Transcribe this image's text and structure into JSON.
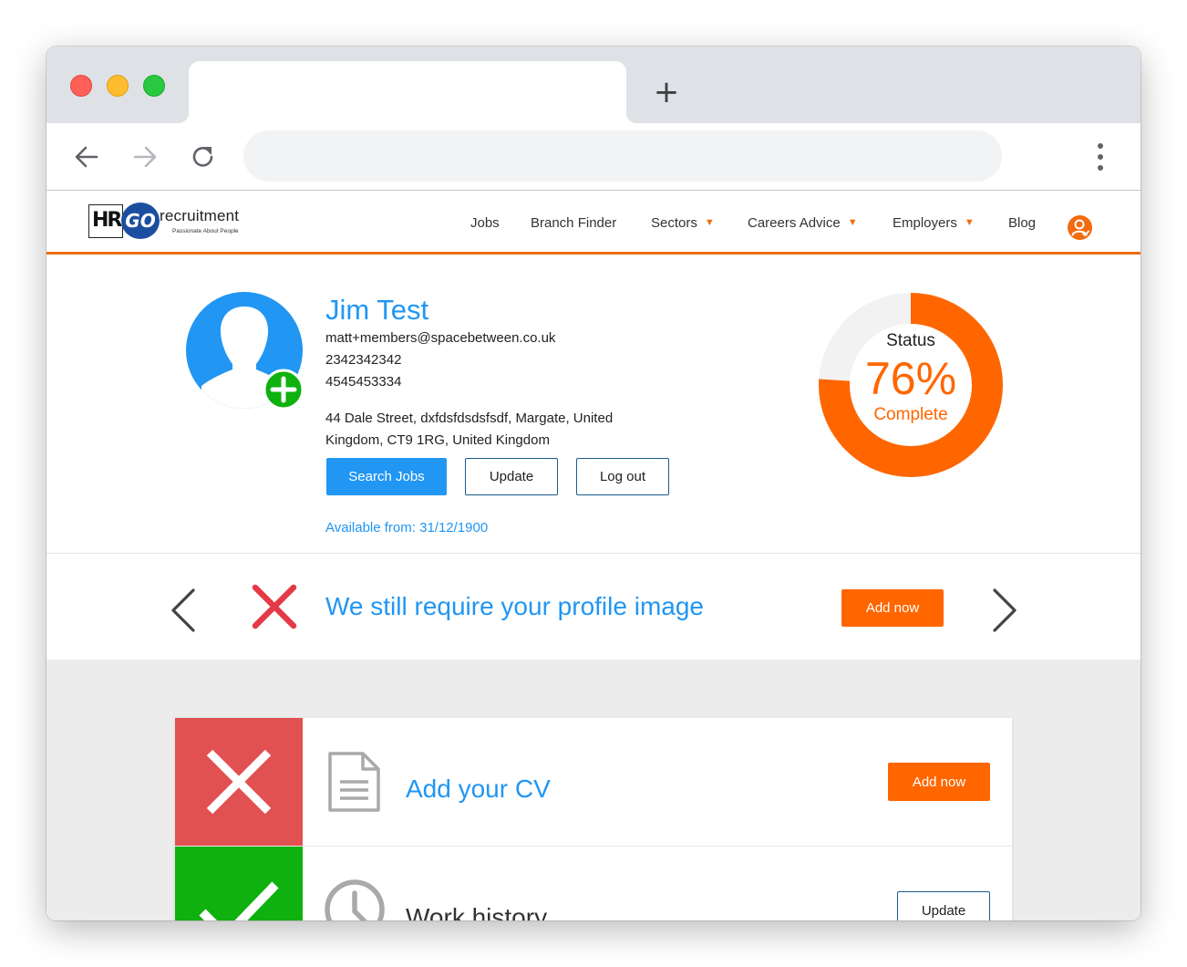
{
  "browser": {
    "new_tab_glyph": "+"
  },
  "site": {
    "logo": {
      "hr": "HR",
      "go": "GO",
      "word": "recruitment",
      "tagline": "Passionate About People"
    },
    "nav": {
      "jobs": "Jobs",
      "branch_finder": "Branch Finder",
      "sectors": "Sectors",
      "careers_advice": "Careers Advice",
      "employers": "Employers",
      "blog": "Blog",
      "caret": "▼"
    },
    "colors": {
      "brand_orange": "#f26b0f",
      "action_orange": "#ff6600",
      "accent_blue": "#2196f3",
      "error_red": "#e53946",
      "success_green": "#0eb10e"
    }
  },
  "profile": {
    "name": "Jim Test",
    "email": "matt+members@spacebetween.co.uk",
    "phone1": "2342342342",
    "phone2": "4545453334",
    "address_line1": "44 Dale Street, dxfdsfdsdsfsdf, Margate, United",
    "address_line2": "Kingdom, CT9 1RG, United Kingdom",
    "buttons": {
      "search": "Search Jobs",
      "update": "Update",
      "logout": "Log out"
    },
    "available": "Available from: 31/12/1900"
  },
  "status": {
    "label": "Status",
    "percent_text": "76%",
    "complete_label": "Complete",
    "percent_value": 76
  },
  "prompt": {
    "text": "We still require your profile image",
    "button": "Add now"
  },
  "checklist": [
    {
      "title": "Add your CV",
      "button": "Add now",
      "state": "missing",
      "icon": "document-icon"
    },
    {
      "title": "Work history",
      "button": "Update",
      "state": "done",
      "icon": "clock-icon"
    }
  ]
}
